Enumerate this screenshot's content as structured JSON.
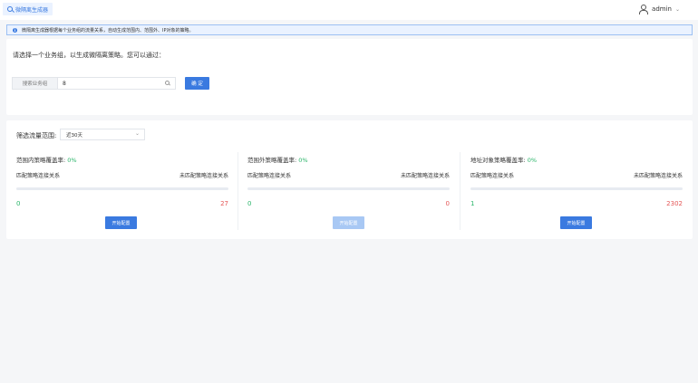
{
  "header": {
    "tab_label": "微隔离生成器",
    "user_name": "admin"
  },
  "info": {
    "text": "微隔离生成器根据每个业务组的流量关系，自动生成范围内、范围外、IP对象的策略。"
  },
  "selection": {
    "prompt": "请选择一个业务组，以生成微隔离策略。您可以通过：",
    "search_label": "搜索业务组",
    "search_value": "8",
    "confirm_label": "确 定"
  },
  "filter": {
    "label": "筛选流量范围:",
    "selected": "近30天"
  },
  "columns": [
    {
      "title": "范围内策略覆盖率:",
      "coverage": "0%",
      "matched_label": "匹配策略连接关系",
      "unmatched_label": "未匹配策略连接关系",
      "matched": "0",
      "unmatched": "27",
      "coverage_fraction": 0,
      "button_label": "开始配置",
      "button_enabled": true
    },
    {
      "title": "范围外策略覆盖率:",
      "coverage": "0%",
      "matched_label": "匹配策略连接关系",
      "unmatched_label": "未匹配策略连接关系",
      "matched": "0",
      "unmatched": "0",
      "coverage_fraction": 0,
      "button_label": "开始配置",
      "button_enabled": false
    },
    {
      "title": "地址对象策略覆盖率:",
      "coverage": "0%",
      "matched_label": "匹配策略连接关系",
      "unmatched_label": "未匹配策略连接关系",
      "matched": "1",
      "unmatched": "2302",
      "coverage_fraction": 0,
      "button_label": "开始配置",
      "button_enabled": true
    }
  ],
  "colors": {
    "primary": "#3a7ae0",
    "success": "#2bb56a",
    "danger": "#e45656"
  }
}
